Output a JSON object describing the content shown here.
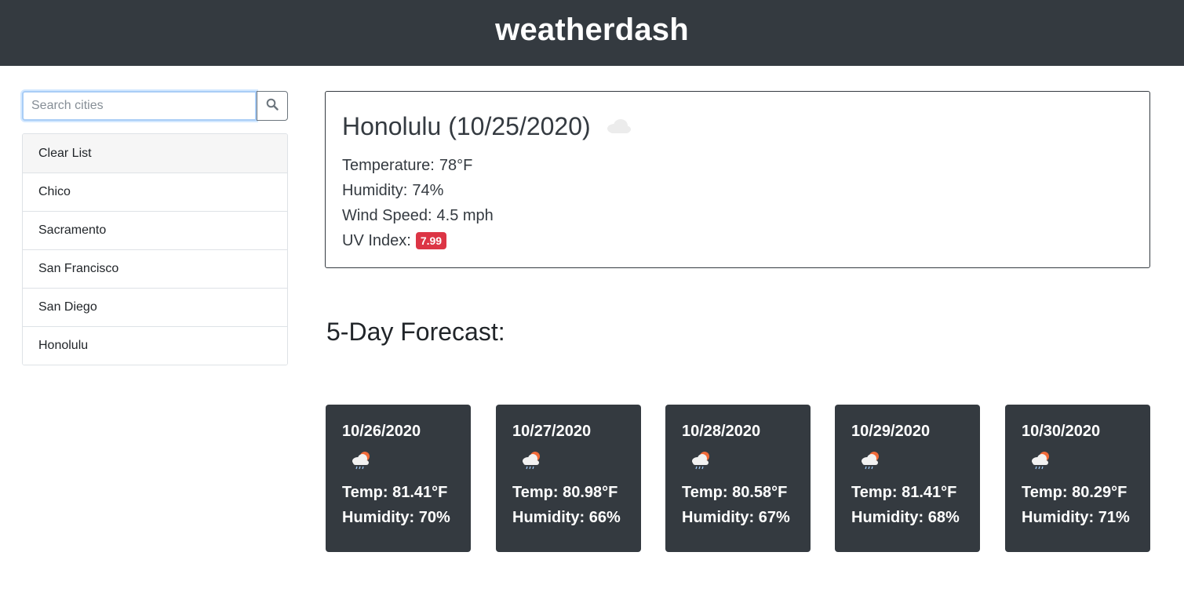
{
  "header": {
    "title": "weatherdash"
  },
  "search": {
    "placeholder": "Search cities",
    "value": ""
  },
  "sidebar": {
    "clear_label": "Clear List",
    "items": [
      "Chico",
      "Sacramento",
      "San Francisco",
      "San Diego",
      "Honolulu"
    ]
  },
  "current": {
    "city": "Honolulu",
    "date": "(10/25/2020)",
    "icon": "cloud-icon",
    "temperature_label": "Temperature:",
    "temperature": "78°F",
    "humidity_label": "Humidity:",
    "humidity": "74%",
    "wind_label": "Wind Speed:",
    "wind": "4.5 mph",
    "uv_label": "UV Index:",
    "uv": "7.99",
    "uv_color": "#dc3545"
  },
  "forecast": {
    "title": "5-Day Forecast:",
    "days": [
      {
        "date": "10/26/2020",
        "icon": "rain-sun-cloud-icon",
        "temp": "Temp: 81.41°F",
        "humidity": "Humidity: 70%"
      },
      {
        "date": "10/27/2020",
        "icon": "rain-sun-cloud-icon",
        "temp": "Temp: 80.98°F",
        "humidity": "Humidity: 66%"
      },
      {
        "date": "10/28/2020",
        "icon": "rain-sun-cloud-icon",
        "temp": "Temp: 80.58°F",
        "humidity": "Humidity: 67%"
      },
      {
        "date": "10/29/2020",
        "icon": "rain-sun-cloud-icon",
        "temp": "Temp: 81.41°F",
        "humidity": "Humidity: 68%"
      },
      {
        "date": "10/30/2020",
        "icon": "rain-sun-cloud-icon",
        "temp": "Temp: 80.29°F",
        "humidity": "Humidity: 71%"
      }
    ]
  },
  "colors": {
    "header_bg": "#343a40",
    "card_bg": "#343a40",
    "uv_badge": "#dc3545",
    "focus_ring": "#a9cdf6"
  }
}
